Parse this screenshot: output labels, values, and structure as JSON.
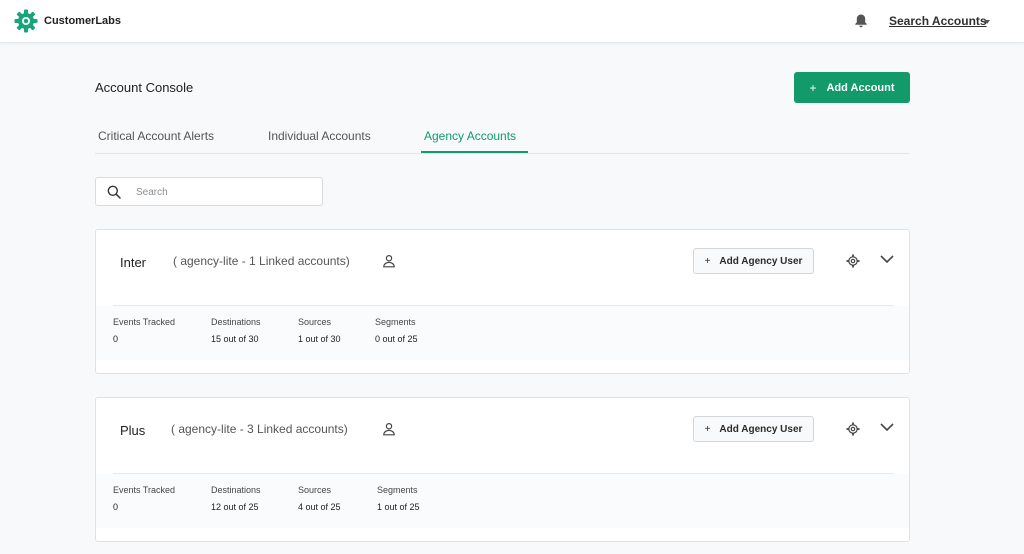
{
  "header": {
    "brand": "CustomerLabs",
    "search_accounts": "Search Accounts",
    "brand_color": "#129a6b"
  },
  "page": {
    "title": "Account Console",
    "add_account_plus": "+",
    "add_account": "Add Account"
  },
  "tabs": [
    {
      "label": "Critical Account Alerts",
      "active": false
    },
    {
      "label": "Individual Accounts",
      "active": false
    },
    {
      "label": "Agency Accounts",
      "active": true
    }
  ],
  "search": {
    "placeholder": "Search",
    "value": ""
  },
  "accounts": [
    {
      "name": "Inter",
      "meta": "( agency-lite - 1 Linked accounts)",
      "add_user_plus": "+",
      "add_user": "Add Agency User",
      "stats": [
        {
          "label": "Events Tracked",
          "value": "0"
        },
        {
          "label": "Destinations",
          "value": "15 out of 30"
        },
        {
          "label": "Sources",
          "value": "1 out of 30"
        },
        {
          "label": "Segments",
          "value": "0 out of 25"
        }
      ]
    },
    {
      "name": "Plus",
      "meta": "( agency-lite - 3 Linked accounts)",
      "add_user_plus": "+",
      "add_user": "Add Agency User",
      "stats": [
        {
          "label": "Events Tracked",
          "value": "0"
        },
        {
          "label": "Destinations",
          "value": "12 out of 25"
        },
        {
          "label": "Sources",
          "value": "4 out of 25"
        },
        {
          "label": "Segments",
          "value": "1 out of 25"
        }
      ]
    }
  ],
  "icons": [
    "logo-gear-icon",
    "bell-icon",
    "caret-down-icon",
    "search-icon",
    "user-icon",
    "gear-icon",
    "chevron-down-icon"
  ]
}
